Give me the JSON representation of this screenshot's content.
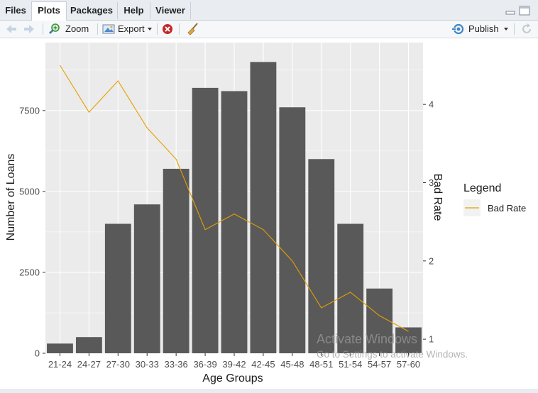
{
  "tabs": [
    {
      "label": "Files",
      "active": false
    },
    {
      "label": "Plots",
      "active": true
    },
    {
      "label": "Packages",
      "active": false
    },
    {
      "label": "Help",
      "active": false
    },
    {
      "label": "Viewer",
      "active": false
    }
  ],
  "toolbar": {
    "zoom_label": "Zoom",
    "export_label": "Export",
    "publish_label": "Publish"
  },
  "watermark": {
    "line1": "Activate Windows",
    "line2": "Go to Settings to activate Windows."
  },
  "colors": {
    "bar": "#595959",
    "line": "#e69f00",
    "panel": "#ebebeb",
    "grid": "#ffffff"
  },
  "chart_data": {
    "type": "bar",
    "categories": [
      "21-24",
      "24-27",
      "27-30",
      "30-33",
      "33-36",
      "36-39",
      "39-42",
      "42-45",
      "45-48",
      "48-51",
      "51-54",
      "54-57",
      "57-60"
    ],
    "series": [
      {
        "values": [
          300,
          500,
          4000,
          4600,
          5700,
          8200,
          8100,
          9000,
          7600,
          6000,
          4000,
          2000,
          800
        ],
        "axis": "left",
        "kind": "bar"
      },
      {
        "name": "Bad Rate",
        "values": [
          4.5,
          3.9,
          4.3,
          3.7,
          3.3,
          2.4,
          2.6,
          2.4,
          2.0,
          1.4,
          1.6,
          1.3,
          1.1
        ],
        "axis": "right",
        "kind": "line"
      }
    ],
    "xlabel": "Age Groups",
    "ylabel": "Number of Loans",
    "y2label": "Bad Rate",
    "ylim": [
      0,
      9000
    ],
    "y2lim": [
      1,
      4.5
    ],
    "yticks": [
      0,
      2500,
      5000,
      7500
    ],
    "y2ticks": [
      1,
      2,
      3,
      4
    ],
    "legend_title": "Legend",
    "legend_position": "right",
    "grid": true
  }
}
